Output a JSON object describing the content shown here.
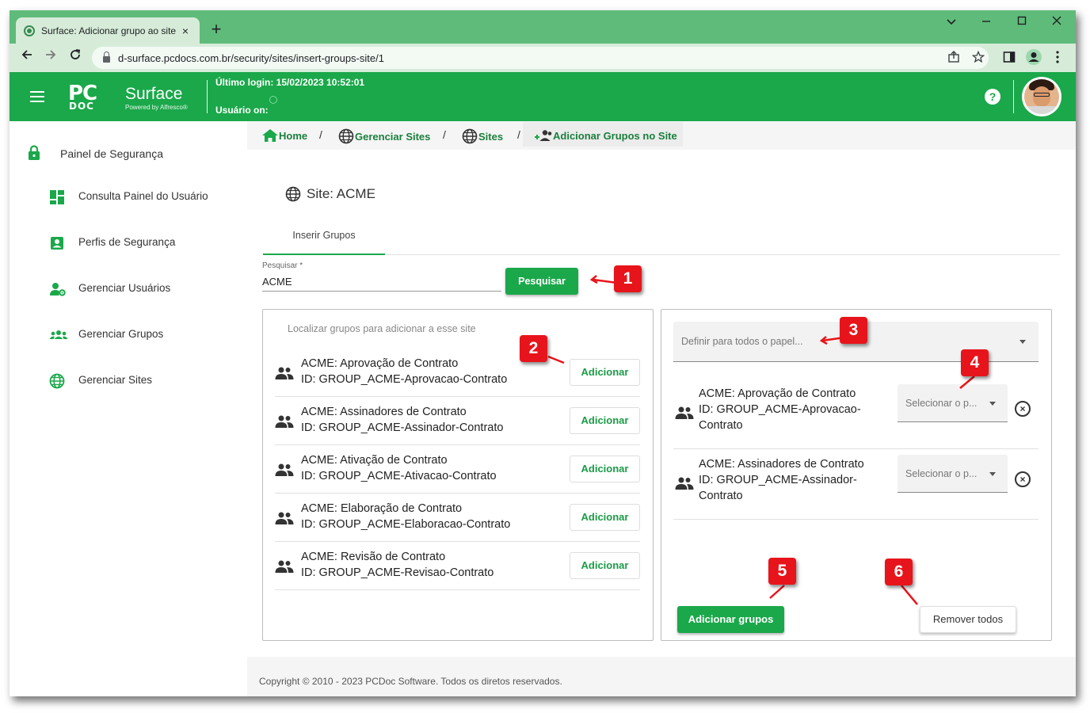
{
  "browser": {
    "tab_title": "Surface: Adicionar grupo ao site",
    "tab_close": "×",
    "new_tab": "+",
    "url": "d-surface.pcdocs.com.br/security/sites/insert-groups-site/1"
  },
  "header": {
    "logo_pc": "PC",
    "logo_doc": "DOC",
    "logo_surface": "Surface",
    "logo_powered": "Powered by Alfresco®",
    "last_login": "Último login: 15/02/2023 10:52:01",
    "user_label": "Usuário on:",
    "help": "?"
  },
  "sidebar": {
    "title": "Painel de Segurança",
    "items": [
      {
        "label": "Consulta Painel do Usuário",
        "icon": "dashboard-icon"
      },
      {
        "label": "Perfis de Segurança",
        "icon": "profile-icon"
      },
      {
        "label": "Gerenciar Usuários",
        "icon": "user-settings-icon"
      },
      {
        "label": "Gerenciar Grupos",
        "icon": "groups-icon"
      },
      {
        "label": "Gerenciar Sites",
        "icon": "globe-icon"
      }
    ]
  },
  "breadcrumb": {
    "items": [
      "Home",
      "Gerenciar Sites",
      "Sites",
      "Adicionar Grupos no Site"
    ],
    "separator": "/"
  },
  "page": {
    "site_title": "Site: ACME",
    "tab_label": "Inserir Grupos",
    "search_label": "Pesquisar *",
    "search_value": "ACME",
    "search_button": "Pesquisar"
  },
  "left_panel": {
    "caption": "Localizar grupos para adicionar a esse site",
    "add_label": "Adicionar",
    "groups": [
      {
        "name": "ACME: Aprovação de Contrato",
        "id": "ID: GROUP_ACME-Aprovacao-Contrato"
      },
      {
        "name": "ACME: Assinadores de Contrato",
        "id": "ID: GROUP_ACME-Assinador-Contrato"
      },
      {
        "name": "ACME: Ativação de Contrato",
        "id": "ID: GROUP_ACME-Ativacao-Contrato"
      },
      {
        "name": "ACME: Elaboração de Contrato",
        "id": "ID: GROUP_ACME-Elaboracao-Contrato"
      },
      {
        "name": "ACME: Revisão de Contrato",
        "id": "ID: GROUP_ACME-Revisao-Contrato"
      }
    ]
  },
  "right_panel": {
    "role_all_placeholder": "Definir para todos o papel...",
    "role_placeholder": "Selecionar o p...",
    "selected": [
      {
        "line1": "ACME: Aprovação de Contrato",
        "line2": "ID: GROUP_ACME-Aprovacao-",
        "line3": "Contrato"
      },
      {
        "line1": "ACME: Assinadores de Contrato",
        "line2": "ID: GROUP_ACME-Assinador-",
        "line3": "Contrato"
      }
    ],
    "add_groups_button": "Adicionar grupos",
    "remove_all_button": "Remover todos"
  },
  "footer": {
    "copyright": "Copyright © 2010 - 2023 PCDoc Software. Todos os diretos reservados."
  },
  "callouts": [
    "1",
    "2",
    "3",
    "4",
    "5",
    "6"
  ],
  "colors": {
    "brand_green": "#1aa84a",
    "chrome_green": "#5fbb7a",
    "callout_red": "#e8141b"
  }
}
